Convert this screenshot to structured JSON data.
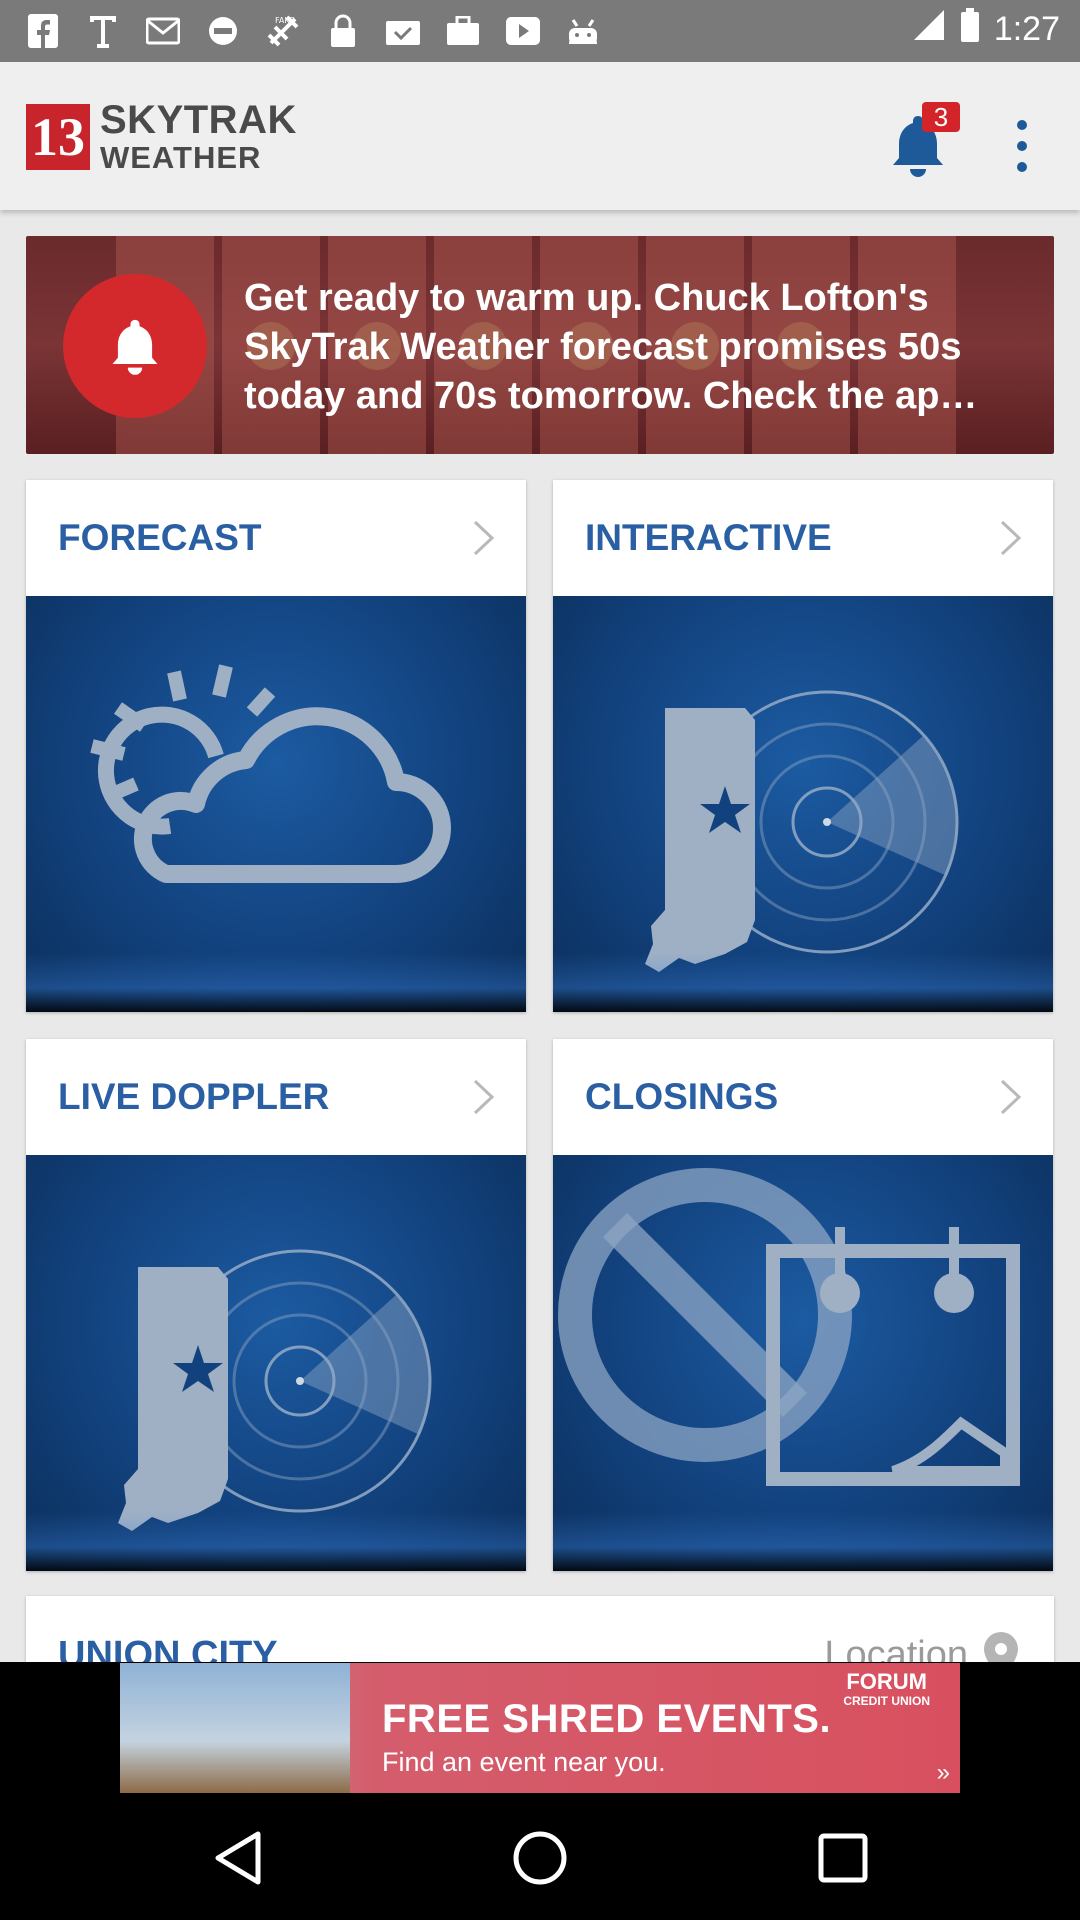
{
  "status_bar": {
    "time": "1:27",
    "notification_icons": [
      "facebook-icon",
      "text-icon",
      "mail-icon",
      "dnd-icon",
      "fake-gps-icon",
      "lock-icon",
      "check-icon",
      "briefcase-icon",
      "play-icon",
      "android-icon"
    ]
  },
  "app_bar": {
    "logo_number": "13",
    "logo_line1": "SKYTRAK",
    "logo_line2": "WEATHER",
    "notification_count": "3",
    "brand_color": "#1e5a99",
    "badge_color": "#d3242a"
  },
  "alert": {
    "message": "Get ready to warm up. Chuck Lofton's SkyTrak Weather forecast promises 50s today and 70s tomorrow. Check the ap…"
  },
  "cards": [
    {
      "title": "FORECAST",
      "icon": "sun-cloud-icon"
    },
    {
      "title": "INTERACTIVE",
      "icon": "indiana-radar-icon"
    },
    {
      "title": "LIVE DOPPLER",
      "icon": "indiana-radar-icon"
    },
    {
      "title": "CLOSINGS",
      "icon": "closed-calendar-icon"
    }
  ],
  "location": {
    "city": "UNION CITY",
    "label": "Location"
  },
  "ad": {
    "brand_line1": "FORUM",
    "brand_line2": "CREDIT UNION",
    "headline": "FREE SHRED EVENTS.",
    "subline": "Find an event near you."
  }
}
